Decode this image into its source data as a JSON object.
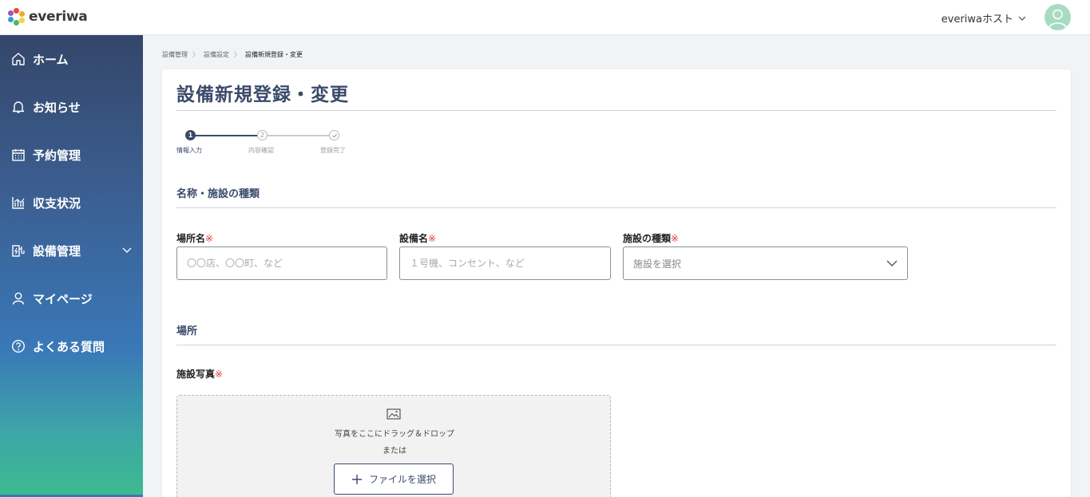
{
  "header": {
    "logo_text": "everiwa",
    "user_name": "everiwaホスト",
    "colors": {
      "accent": "#3b4a6b",
      "avatar": "#a7dcc2",
      "required": "#e33a3a"
    }
  },
  "sidebar": {
    "items": [
      {
        "label": "ホーム",
        "icon": "home-icon"
      },
      {
        "label": "お知らせ",
        "icon": "bell-icon"
      },
      {
        "label": "予約管理",
        "icon": "calendar-icon"
      },
      {
        "label": "収支状況",
        "icon": "chart-icon"
      },
      {
        "label": "設備管理",
        "icon": "plug-icon",
        "expandable": true
      },
      {
        "label": "マイページ",
        "icon": "user-icon"
      },
      {
        "label": "よくある質問",
        "icon": "question-icon"
      }
    ]
  },
  "breadcrumb": {
    "items": [
      "設備管理",
      "設備設定",
      "設備新規登録・変更"
    ]
  },
  "page": {
    "title": "設備新規登録・変更",
    "stepper": {
      "current_step": 1,
      "steps": [
        {
          "label": "情報入力",
          "marker": "1"
        },
        {
          "label": "内容確認",
          "marker": "2"
        },
        {
          "label": "登録完了",
          "marker": "check"
        }
      ]
    },
    "section_name": {
      "title": "名称・施設の種類",
      "place_name": {
        "label": "場所名",
        "required_mark": "※",
        "placeholder": "〇〇店、〇〇町、など",
        "value": ""
      },
      "equipment_name": {
        "label": "設備名",
        "required_mark": "※",
        "placeholder": "１号機、コンセント、など",
        "value": ""
      },
      "facility_type": {
        "label": "施設の種類",
        "required_mark": "※",
        "placeholder": "施設を選択"
      }
    },
    "section_place": {
      "title": "場所",
      "photo": {
        "label": "施設写真",
        "required_mark": "※",
        "drop_text": "写真をここにドラッグ＆ドロップ",
        "or_text": "または",
        "button_label": "ファイルを選択"
      }
    }
  }
}
